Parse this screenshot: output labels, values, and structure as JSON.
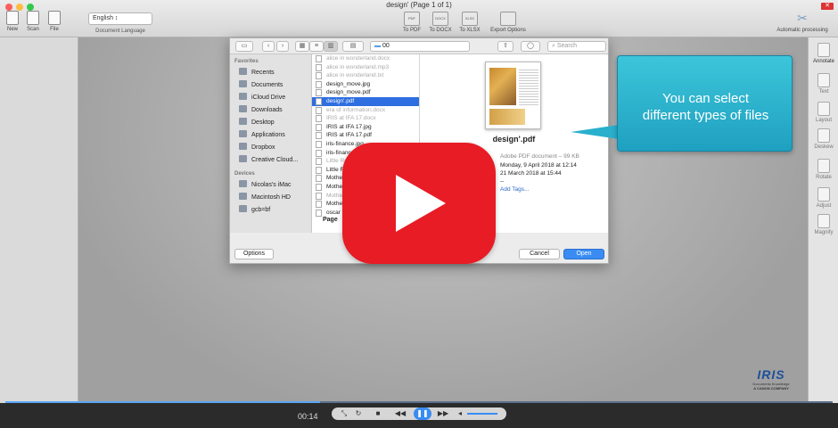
{
  "window": {
    "title": "design' (Page 1 of 1)"
  },
  "toolbar": {
    "new_label": "New",
    "scan_label": "Scan",
    "file_label": "File",
    "language_value": "English ↕",
    "language_label": "Document Language",
    "to_pdf_label": "To PDF",
    "to_docx_label": "To DOCX",
    "to_xlsx_label": "To XLSX",
    "export_label": "Export Options",
    "pdf_icon": "PDF",
    "docx_icon": "DOCX",
    "xlsx_icon": "XLSX",
    "auto_label": "Automatic processing"
  },
  "right_tools": [
    "Annotate",
    "Text",
    "Layout",
    "Deskew",
    "Rotate",
    "Adjust",
    "Magnify"
  ],
  "dialog": {
    "path_value": "00",
    "search_placeholder": "Search",
    "favorites_header": "Favorites",
    "favorites": [
      "Recents",
      "Documents",
      "iCloud Drive",
      "Downloads",
      "Desktop",
      "Applications",
      "Dropbox",
      "Creative Cloud..."
    ],
    "devices_header": "Devices",
    "devices": [
      "Nicolas's iMac",
      "Macintosh HD",
      "gcb=bf"
    ],
    "files": [
      {
        "name": "alice in wonderland.docx",
        "state": "dim"
      },
      {
        "name": "alice in wonderland.mp3",
        "state": "dim"
      },
      {
        "name": "alice in wonderland.txt",
        "state": "dim"
      },
      {
        "name": "design_move.jpg",
        "state": "normal"
      },
      {
        "name": "design_move.pdf",
        "state": "normal"
      },
      {
        "name": "design'.pdf",
        "state": "selected"
      },
      {
        "name": "era of information.docx",
        "state": "dim"
      },
      {
        "name": "IRIS at IFA 17.docx",
        "state": "dim"
      },
      {
        "name": "IRIS at IFA 17.jpg",
        "state": "normal"
      },
      {
        "name": "IRIS at IFA 17.pdf",
        "state": "normal"
      },
      {
        "name": "iris-finance.jpg",
        "state": "normal"
      },
      {
        "name": "iris-finance.pdf",
        "state": "normal"
      },
      {
        "name": "Little Red Riding Hood.docx",
        "state": "dim"
      },
      {
        "name": "Little Red",
        "state": "normal"
      },
      {
        "name": "Mothe",
        "state": "normal"
      },
      {
        "name": "Mothe",
        "state": "normal"
      },
      {
        "name": "Mothe",
        "state": "dim"
      },
      {
        "name": "Mothe",
        "state": "normal"
      },
      {
        "name": "oscar",
        "state": "normal"
      }
    ],
    "preview": {
      "name": "design'.pdf",
      "kind": "Adobe PDF document – 99 KB",
      "created_key": "ated",
      "created_value": "Monday, 9 April 2018 at 12:14",
      "modified_key": "d",
      "modified_value": "21 March 2018 at 15:44",
      "last_value": "--",
      "add_tags": "Add Tags..."
    },
    "page_label": "Page",
    "options_label": "Options",
    "cancel_label": "Cancel",
    "open_label": "Open"
  },
  "callout": {
    "line1": "You can select",
    "line2": "different types of files"
  },
  "logo": {
    "name": "IRIS",
    "tagline": "Documents Knowledge",
    "company": "A CANON COMPANY"
  },
  "player": {
    "time": "00:14",
    "progress": 0.38
  },
  "colors": {
    "accent": "#3a8cf2",
    "play_red": "#e81c25",
    "callout": "#29b0cc"
  }
}
